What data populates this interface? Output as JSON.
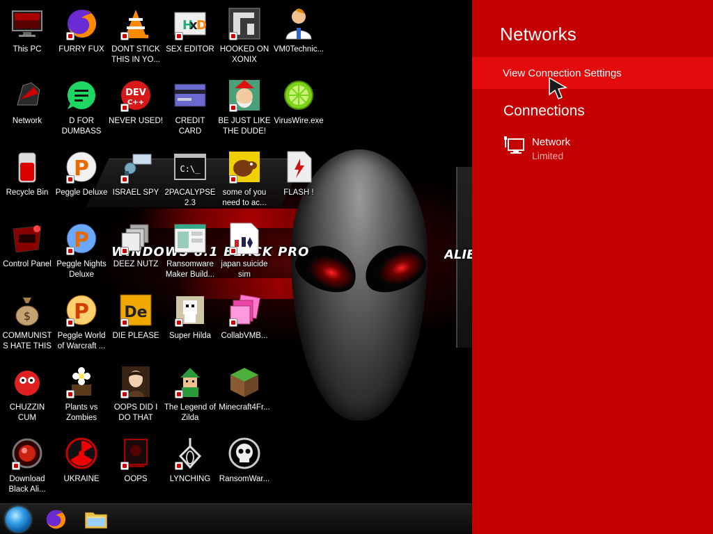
{
  "desktop": {
    "wallpaper_text": "WINDOWS 8.1 BLACK PRO",
    "wallpaper_text_right": "ALIEN",
    "icons": [
      {
        "label": "This PC",
        "icon": "monitor-icon"
      },
      {
        "label": "FURRY FUX",
        "icon": "firefox-icon"
      },
      {
        "label": "DONT STICK THIS IN YO...",
        "icon": "vlc-cone-icon"
      },
      {
        "label": "SEX EDITOR",
        "icon": "hxd-icon"
      },
      {
        "label": "HOOKED ON XONIX",
        "icon": "xonix-icon"
      },
      {
        "label": "VM0Technic...",
        "icon": "doctor-icon"
      },
      {
        "label": "Network",
        "icon": "network-icon"
      },
      {
        "label": "D FOR DUMBASS",
        "icon": "chat-bubble-icon"
      },
      {
        "label": "NEVER USED!",
        "icon": "dev-cpp-icon"
      },
      {
        "label": "CREDIT CARD CHECKER",
        "icon": "credit-card-icon"
      },
      {
        "label": "BE JUST LIKE THE DUDE!",
        "icon": "elf-icon"
      },
      {
        "label": "VirusWire.exe",
        "icon": "lime-icon"
      },
      {
        "label": "Recycle Bin",
        "icon": "recycle-bin-icon"
      },
      {
        "label": "Peggle Deluxe",
        "icon": "peggle-icon"
      },
      {
        "label": "ISRAEL SPY",
        "icon": "spy-tool-icon"
      },
      {
        "label": "2PACALYPSE 2.3",
        "icon": "terminal-icon"
      },
      {
        "label": "some of you need to ac...",
        "icon": "dog-icon"
      },
      {
        "label": "FLASH !",
        "icon": "flash-document-icon"
      },
      {
        "label": "Control Panel",
        "icon": "control-panel-icon"
      },
      {
        "label": "Peggle Nights Deluxe",
        "icon": "peggle-icon"
      },
      {
        "label": "DEEZ NUTZ",
        "icon": "stacked-windows-icon"
      },
      {
        "label": "Ransomware Maker Build...",
        "icon": "app-window-icon"
      },
      {
        "label": "japan suicide sim",
        "icon": "japan-sim-icon"
      },
      {
        "label": "COMMUNISTS HATE THIS G...",
        "icon": "money-bag-icon"
      },
      {
        "label": "Peggle World of Warcraft ...",
        "icon": "peggle-icon"
      },
      {
        "label": "DIE PLEASE",
        "icon": "de-icon"
      },
      {
        "label": "Super Hilda",
        "icon": "pixel-character-icon"
      },
      {
        "label": "CollabVMB...",
        "icon": "pink-cards-icon"
      },
      {
        "label": "CHUZZIN CUM",
        "icon": "chuzzle-icon"
      },
      {
        "label": "Plants vs Zombies",
        "icon": "flower-icon"
      },
      {
        "label": "OOPS DID I DO THAT",
        "icon": "portrait-icon"
      },
      {
        "label": "The Legend of Zilda",
        "icon": "zelda-icon"
      },
      {
        "label": "Minecraft4Fr...",
        "icon": "grass-block-icon"
      },
      {
        "label": "Download Black Ali...",
        "icon": "red-orb-icon"
      },
      {
        "label": "UKRAINE",
        "icon": "radiation-icon"
      },
      {
        "label": "OOPS",
        "icon": "dark-monitor-icon"
      },
      {
        "label": "LYNCHING",
        "icon": "noose-icon"
      },
      {
        "label": "RansomWar...",
        "icon": "skull-icon"
      }
    ]
  },
  "taskbar": {
    "items": [
      {
        "icon": "start-orb-icon"
      },
      {
        "icon": "firefox-icon"
      },
      {
        "icon": "file-explorer-icon"
      }
    ]
  },
  "flyout": {
    "title": "Networks",
    "view_settings": "View Connection Settings",
    "connections_heading": "Connections",
    "network": {
      "name": "Network",
      "status": "Limited"
    },
    "colors": {
      "background": "#c40000",
      "highlight": "#e20a0a",
      "text": "#ffffff"
    }
  }
}
